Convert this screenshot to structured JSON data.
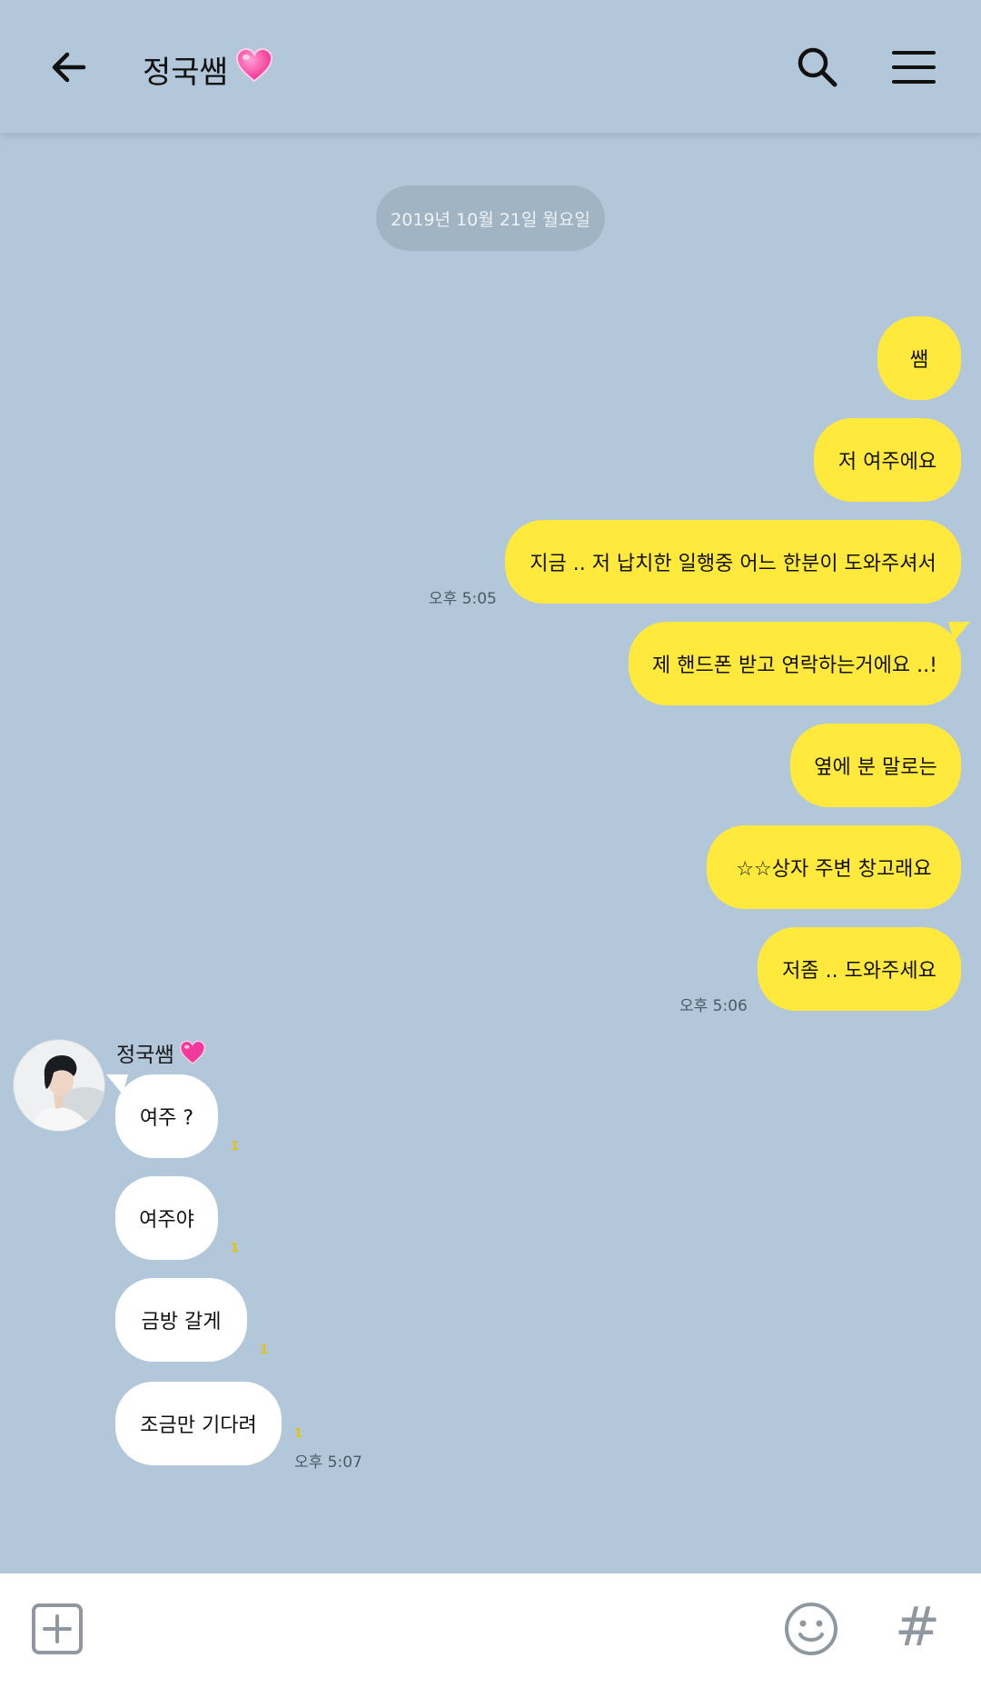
{
  "header": {
    "title": "정국쌤",
    "title_emoji": "💗"
  },
  "date_divider": "2019년 10월 21일 월요일",
  "my_messages": [
    {
      "text": "쌤"
    },
    {
      "text": "저 여주에요"
    },
    {
      "text": "지금 .. 저 납치한 일행중 어느 한분이 도와주셔서"
    },
    {
      "text": "제 핸드폰 받고 연락하는거에요 ..!"
    },
    {
      "text": "옆에 분 말로는"
    },
    {
      "text": "☆☆상자 주변 창고래요"
    },
    {
      "text": "저좀 .. 도와주세요"
    }
  ],
  "my_times": [
    "오후 5:05",
    "오후 5:06"
  ],
  "sender": {
    "name": "정국쌤",
    "emoji": "💗"
  },
  "their_messages": [
    {
      "text": "여주 ?",
      "unread": "1"
    },
    {
      "text": "여주야",
      "unread": "1"
    },
    {
      "text": "금방 갈게",
      "unread": "1"
    },
    {
      "text": "조금만 기다려",
      "unread": "1"
    }
  ],
  "their_time": "오후 5:07",
  "colors": {
    "background": "#b2c7d9",
    "my_bubble": "#fee93c",
    "their_bubble": "#ffffff",
    "unread": "#e5c300"
  },
  "icons": {
    "back": "arrow-left-icon",
    "search": "search-icon",
    "menu": "hamburger-menu-icon",
    "plus": "plus-square-icon",
    "emoji": "smiley-icon",
    "hash": "hash-icon"
  },
  "footer": {
    "hash_symbol": "#"
  }
}
